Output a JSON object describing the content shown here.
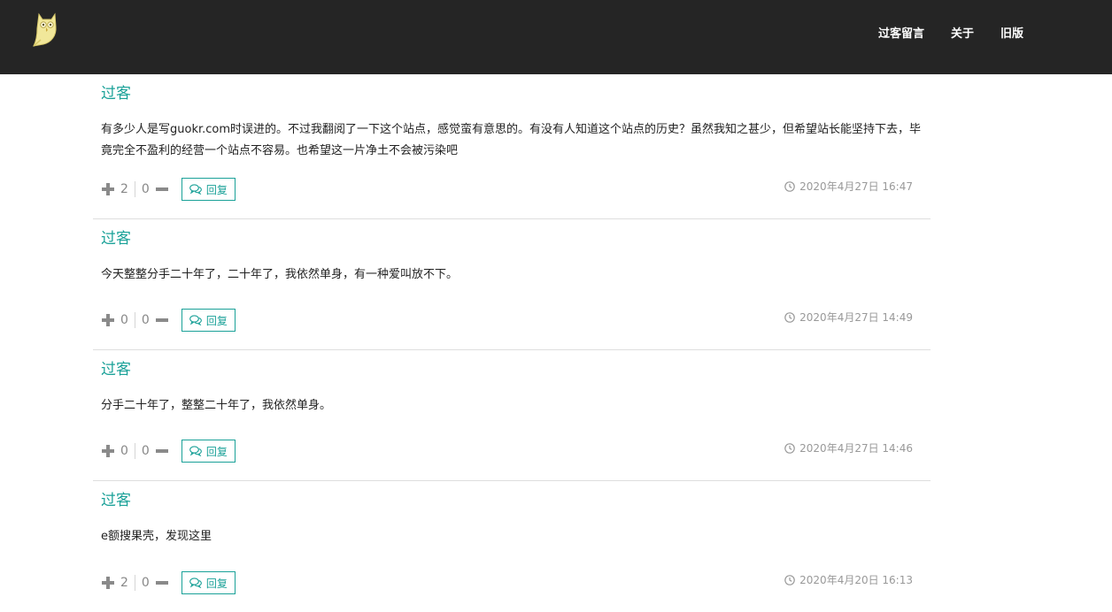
{
  "nav": {
    "links": [
      "过客留言",
      "关于",
      "旧版"
    ]
  },
  "colors": {
    "accent": "#1aa198",
    "navbar": "#252525"
  },
  "comments": [
    {
      "author": "过客",
      "content": "有多少人是写guokr.com时误进的。不过我翻阅了一下这个站点，感觉蛮有意思的。有没有人知道这个站点的历史？虽然我知之甚少，但希望站长能坚持下去，毕竟完全不盈利的经营一个站点不容易。也希望这一片净土不会被污染吧",
      "up": "2",
      "down": "0",
      "reply": "回复",
      "time": "2020年4月27日 16:47"
    },
    {
      "author": "过客",
      "content": "今天整整分手二十年了，二十年了，我依然单身，有一种爱叫放不下。",
      "up": "0",
      "down": "0",
      "reply": "回复",
      "time": "2020年4月27日 14:49"
    },
    {
      "author": "过客",
      "content": "分手二十年了，整整二十年了，我依然单身。",
      "up": "0",
      "down": "0",
      "reply": "回复",
      "time": "2020年4月27日 14:46"
    },
    {
      "author": "过客",
      "content": "e额搜果壳，发现这里",
      "up": "2",
      "down": "0",
      "reply": "回复",
      "time": "2020年4月20日 16:13"
    }
  ]
}
